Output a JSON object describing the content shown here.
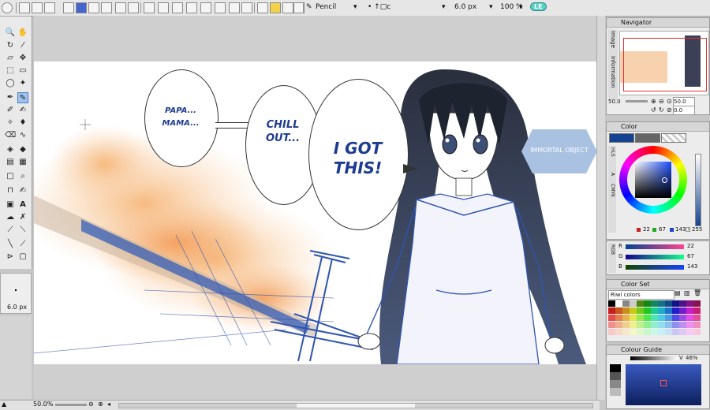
{
  "toolbar": {
    "tool_name": "Pencil",
    "stroke_setting": "• ↑□c",
    "brush_size": "6.0 px",
    "zoom": "100 %",
    "badge": "LE"
  },
  "tool_panel": {
    "brush_size_label": "6.0 px"
  },
  "canvas": {
    "bubbles": [
      {
        "line1": "PAPA...",
        "line2": "MAMA..."
      },
      {
        "line1": "CHILL",
        "line2": "OUT..."
      },
      {
        "line1": "I GOT",
        "line2": "THIS!"
      }
    ],
    "hex_label": "IMMORTAL OBJECT"
  },
  "status": {
    "zoom": "50.0%"
  },
  "navigator": {
    "title": "Navigator",
    "side_tabs": [
      "Image",
      "Information"
    ],
    "zoom_value": "50.0",
    "rotation_value": "0.0",
    "zoom_slider_label": "50.0"
  },
  "color": {
    "title": "Color",
    "side_tabs": [
      "HLS",
      "A",
      "CMYK"
    ],
    "r": "22",
    "g": "67",
    "b": "143",
    "alpha": "255",
    "foreground": "#16438f",
    "background": "#666666"
  },
  "rgb_sliders": {
    "side_tab": "RGB",
    "r": "22",
    "g": "67",
    "b": "143"
  },
  "color_set": {
    "title": "Color Set",
    "set_name": "Riwi colors"
  },
  "color_guide": {
    "title": "Colour Guide",
    "value_label": "V",
    "value": "46%"
  }
}
